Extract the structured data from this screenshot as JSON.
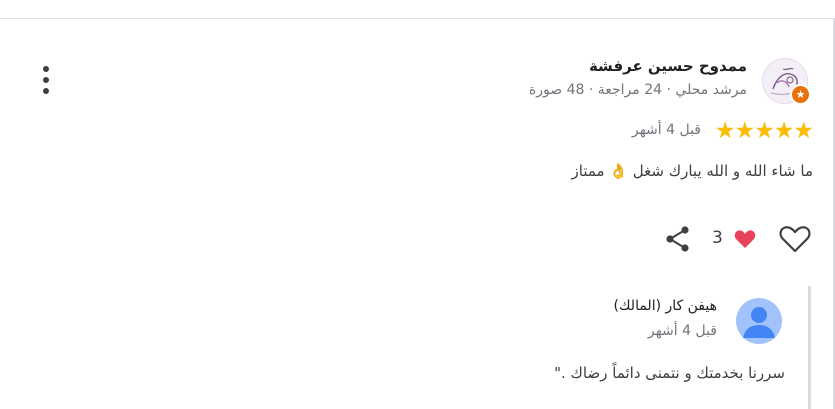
{
  "review": {
    "reviewer_name": "ممدوح حسين عرفشة",
    "reviewer_meta": "مرشد محلي · 24 مراجعة · 48 صورة",
    "stars": "★★★★★",
    "rating": 5,
    "date": "قبل 4 أشهر",
    "text": "ما شاء الله و الله يبارك شغل 👌 ممتاز",
    "reactions_count": "3",
    "icons": {
      "more": "more-vert-icon",
      "like": "heart-outline-icon",
      "reaction": "heart-filled-icon",
      "share": "share-icon",
      "badge": "local-guide-badge-icon"
    }
  },
  "owner_reply": {
    "name": "هيفن كار (المالك)",
    "date": "قبل 4 أشهر",
    "text": "سررنا بخدمتك و نتمنى دائماً رضاك .\""
  },
  "colors": {
    "star": "#fbbc04",
    "badge": "#e8710a",
    "heart": "#e8415a",
    "owner_avatar_bg": "#a1c2fa",
    "owner_avatar_fg": "#4285f4",
    "meta_text": "#70757a"
  }
}
